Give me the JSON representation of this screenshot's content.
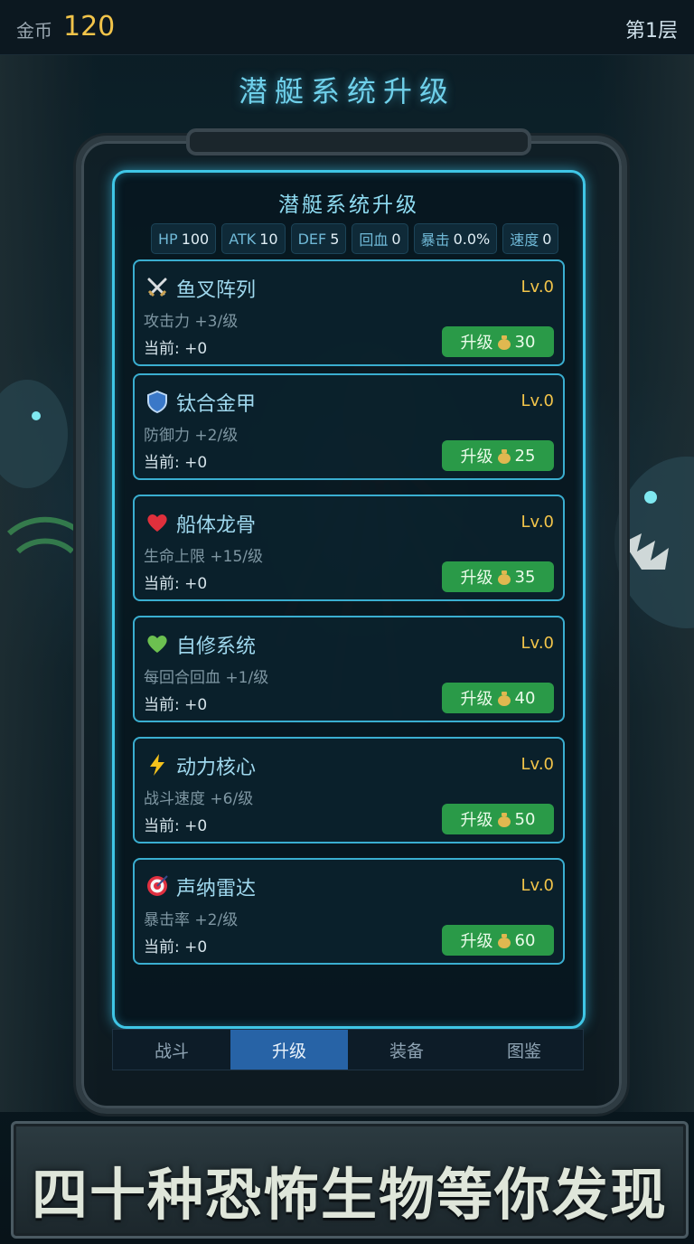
{
  "topbar": {
    "gold_label": "金币",
    "gold_value": "120",
    "floor": "第1层"
  },
  "screen_title": "潜艇系统升级",
  "panel": {
    "title": "潜艇系统升级",
    "stats": [
      {
        "key": "HP",
        "value": "100"
      },
      {
        "key": "ATK",
        "value": "10"
      },
      {
        "key": "DEF",
        "value": "5"
      },
      {
        "key": "回血",
        "value": "0"
      },
      {
        "key": "暴击",
        "value": "0.0%"
      },
      {
        "key": "速度",
        "value": "0"
      }
    ],
    "upgrades": [
      {
        "icon": "crossed-swords-icon",
        "name": "鱼叉阵列",
        "level": "Lv.0",
        "desc": "攻击力 +3/级",
        "current": "当前: +0",
        "button": "升级",
        "cost": "30"
      },
      {
        "icon": "shield-icon",
        "name": "钛合金甲",
        "level": "Lv.0",
        "desc": "防御力 +2/级",
        "current": "当前: +0",
        "button": "升级",
        "cost": "25"
      },
      {
        "icon": "red-heart-icon",
        "name": "船体龙骨",
        "level": "Lv.0",
        "desc": "生命上限 +15/级",
        "current": "当前: +0",
        "button": "升级",
        "cost": "35"
      },
      {
        "icon": "green-heart-icon",
        "name": "自修系统",
        "level": "Lv.0",
        "desc": "每回合回血 +1/级",
        "current": "当前: +0",
        "button": "升级",
        "cost": "40"
      },
      {
        "icon": "lightning-icon",
        "name": "动力核心",
        "level": "Lv.0",
        "desc": "战斗速度 +6/级",
        "current": "当前: +0",
        "button": "升级",
        "cost": "50"
      },
      {
        "icon": "target-icon",
        "name": "声纳雷达",
        "level": "Lv.0",
        "desc": "暴击率 +2/级",
        "current": "当前: +0",
        "button": "升级",
        "cost": "60"
      }
    ]
  },
  "tabs": [
    {
      "label": "战斗",
      "active": false
    },
    {
      "label": "升级",
      "active": true
    },
    {
      "label": "装备",
      "active": false
    },
    {
      "label": "图鉴",
      "active": false
    }
  ],
  "banner": "四十种恐怖生物等你发现",
  "colors": {
    "accent": "#3fc6e6",
    "gold": "#f2c44a",
    "button": "#2a9a48",
    "active_tab": "#2763a6"
  }
}
